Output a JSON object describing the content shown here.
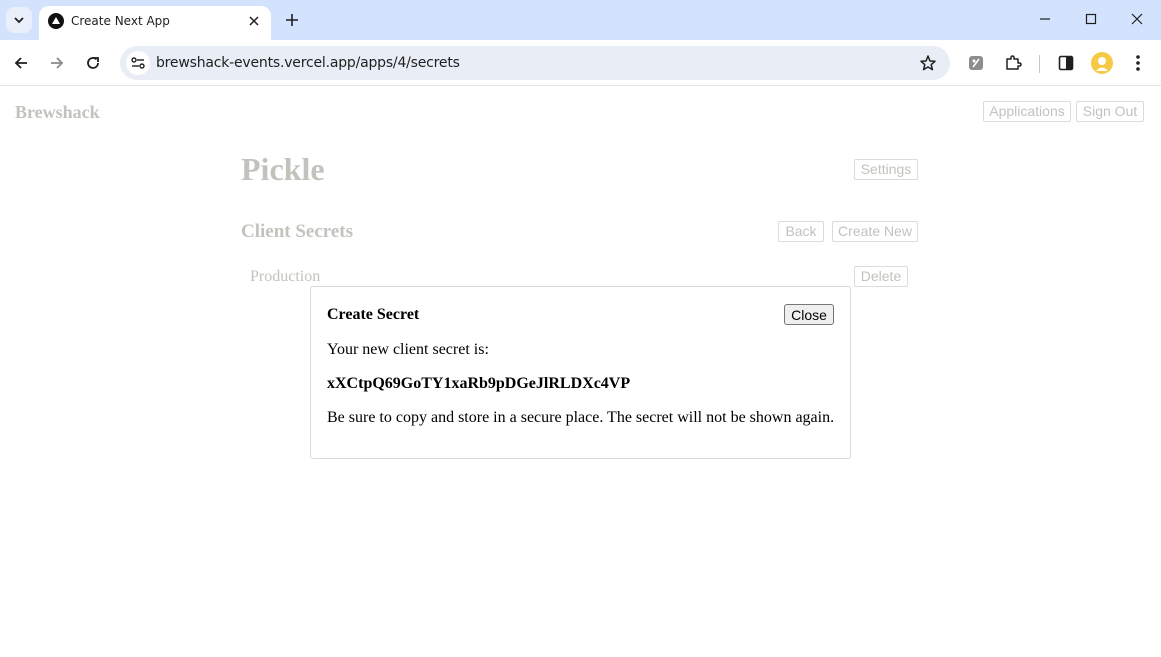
{
  "browser": {
    "tab_title": "Create Next App",
    "url": "brewshack-events.vercel.app/apps/4/secrets",
    "icons": [
      "tab-search-icon",
      "next-favicon-icon",
      "close-tab-icon",
      "new-tab-icon",
      "minimize-icon",
      "maximize-icon",
      "close-window-icon",
      "back-arrow-icon",
      "forward-arrow-icon",
      "reload-icon",
      "site-settings-icon",
      "bookmark-star-icon",
      "extension-icon",
      "puzzle-extensions-icon",
      "side-panel-icon",
      "profile-avatar-icon",
      "more-menu-icon"
    ]
  },
  "header": {
    "brand": "Brewshack",
    "nav": {
      "applications": "Applications",
      "sign_out": "Sign Out"
    }
  },
  "app": {
    "title": "Pickle",
    "settings_label": "Settings",
    "section_title": "Client Secrets",
    "back_label": "Back",
    "create_new_label": "Create New",
    "secrets": [
      {
        "name": "Production",
        "delete_label": "Delete"
      }
    ]
  },
  "modal": {
    "title": "Create Secret",
    "close_label": "Close",
    "intro": "Your new client secret is:",
    "secret": "xXCtpQ69GoTY1xaRb9pDGeJlRLDXc4VP",
    "warning": "Be sure to copy and store in a secure place. The secret will not be shown again."
  },
  "colors": {
    "tabstrip": "#d3e3fd",
    "omnibox": "#e9eef6",
    "dimmed_text": "#c4c2bd"
  }
}
